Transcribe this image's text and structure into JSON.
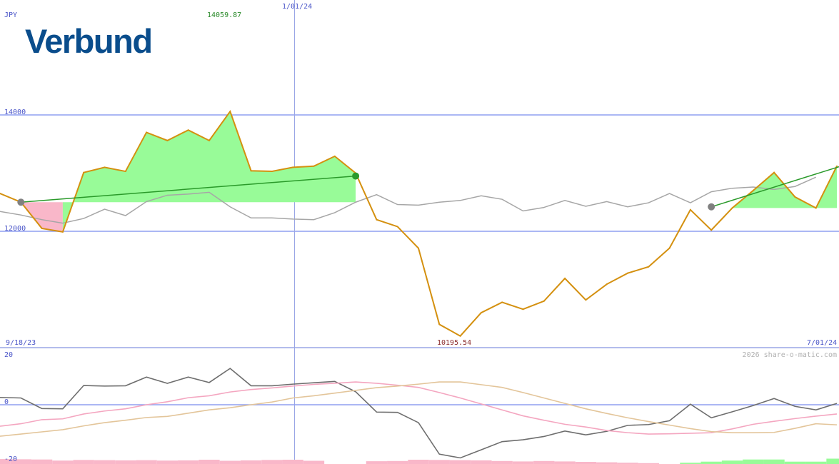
{
  "currency_label": "JPY",
  "logo_text": "Verbund",
  "watermark": "2026 share-o-matic.com",
  "colors": {
    "price": "#d4900f",
    "ma": "#a6a6a6",
    "gain_fill": "#98fb98",
    "loss_fill": "#f9b7c9",
    "trend": "#2a9a2a",
    "grid": "#8f9ff0",
    "divider": "#9aa6e6",
    "axis_text": "#4a55c8",
    "high_text": "#2a8a2a",
    "low_text": "#8a2a2a",
    "logo": "#0a4d8c",
    "osc_dark": "#6e6e6e",
    "osc_pink": "#f4a6c0",
    "osc_tan": "#e3c59a"
  },
  "chart_data": [
    {
      "type": "line",
      "currency": "JPY",
      "ylim": [
        10050,
        14250
      ],
      "x_range": [
        "9/18/23",
        "7/01/24"
      ],
      "x_tick_labels": [
        "9/18/23",
        "1/01/24",
        "7/01/24"
      ],
      "y_tick_labels": [
        "14000",
        "12000"
      ],
      "y_grid_values": [
        14000,
        12000
      ],
      "max_label": "14059.87",
      "min_label": "10195.54",
      "series": [
        {
          "key": "price",
          "x": [
            "2023-09-11",
            "2023-09-18",
            "2023-09-25",
            "2023-10-02",
            "2023-10-09",
            "2023-10-16",
            "2023-10-23",
            "2023-10-30",
            "2023-11-06",
            "2023-11-13",
            "2023-11-20",
            "2023-11-27",
            "2023-12-04",
            "2023-12-11",
            "2023-12-18",
            "2023-12-25",
            "2024-01-01",
            "2024-01-08",
            "2024-01-15",
            "2024-01-22",
            "2024-01-29",
            "2024-02-05",
            "2024-02-12",
            "2024-02-19",
            "2024-02-26",
            "2024-03-04",
            "2024-03-11",
            "2024-03-18",
            "2024-03-25",
            "2024-04-01",
            "2024-04-08",
            "2024-04-15",
            "2024-04-22",
            "2024-04-29",
            "2024-05-06",
            "2024-05-13",
            "2024-05-20",
            "2024-05-27",
            "2024-06-03",
            "2024-06-10",
            "2024-06-17",
            "2024-06-24",
            "2024-07-01"
          ],
          "y": [
            12650,
            12500,
            12050,
            11990,
            13010,
            13100,
            13030,
            13700,
            13560,
            13740,
            13560,
            14060,
            13040,
            13030,
            13100,
            13120,
            13290,
            13000,
            12200,
            12080,
            11710,
            10400,
            10200,
            10600,
            10780,
            10660,
            10800,
            11190,
            10820,
            11090,
            11280,
            11390,
            11710,
            12370,
            12020,
            12400,
            12700,
            13010,
            12590,
            12400,
            13120,
            null,
            null
          ]
        },
        {
          "key": "ma",
          "x": [
            "2023-09-11",
            "2023-09-18",
            "2023-09-25",
            "2023-10-02",
            "2023-10-09",
            "2023-10-16",
            "2023-10-23",
            "2023-10-30",
            "2023-11-06",
            "2023-11-13",
            "2023-11-20",
            "2023-11-27",
            "2023-12-04",
            "2023-12-11",
            "2023-12-18",
            "2023-12-25",
            "2024-01-01",
            "2024-01-08",
            "2024-01-15",
            "2024-01-22",
            "2024-01-29",
            "2024-02-05",
            "2024-02-12",
            "2024-02-19",
            "2024-02-26",
            "2024-03-04",
            "2024-03-11",
            "2024-03-18",
            "2024-03-25",
            "2024-04-01",
            "2024-04-08",
            "2024-04-15",
            "2024-04-22",
            "2024-04-29",
            "2024-05-06",
            "2024-05-13",
            "2024-05-20",
            "2024-05-27",
            "2024-06-03",
            "2024-06-10",
            "2024-06-17",
            "2024-06-24",
            "2024-07-01"
          ],
          "y": [
            12340,
            12280,
            12200,
            12140,
            12220,
            12380,
            12270,
            12510,
            12620,
            12640,
            12670,
            12420,
            12230,
            12230,
            12210,
            12200,
            12320,
            12500,
            12630,
            12460,
            12450,
            12500,
            12530,
            12610,
            12550,
            12350,
            12410,
            12530,
            12430,
            12510,
            12420,
            12490,
            12650,
            12490,
            12680,
            12740,
            12760,
            12720,
            12770,
            12930,
            null,
            null,
            null
          ]
        }
      ],
      "trend_lines": [
        {
          "x": [
            "2023-09-18",
            "2024-01-08"
          ],
          "y": [
            12500,
            12950
          ]
        },
        {
          "x": [
            "2024-05-06",
            "2024-07-01"
          ],
          "y": [
            12420,
            13110
          ]
        }
      ]
    },
    {
      "type": "line",
      "ylim": [
        -21,
        21
      ],
      "y_tick_labels": [
        "20",
        "0",
        "-20"
      ],
      "zero_line": 0,
      "series": [
        {
          "key": "osc_dark",
          "y": [
            2.7,
            2.5,
            -1.4,
            -1.5,
            7.1,
            6.9,
            7.0,
            10.2,
            7.9,
            10.2,
            8.2,
            13.4,
            7.0,
            7.0,
            7.6,
            8.1,
            8.6,
            4.8,
            -2.7,
            -2.8,
            -6.6,
            -18.2,
            -19.6,
            -16.6,
            -13.6,
            -12.9,
            -11.7,
            -9.7,
            -11.1,
            -9.8,
            -7.6,
            -7.3,
            -5.9,
            0.2,
            -4.8,
            -2.6,
            -0.3,
            2.3,
            -0.6,
            -1.9,
            0.5,
            null,
            null
          ]
        },
        {
          "key": "osc_pink",
          "y": [
            -7.9,
            -7.0,
            -5.5,
            -5.2,
            -3.4,
            -2.3,
            -1.5,
            0.0,
            1.1,
            2.6,
            3.3,
            4.7,
            5.6,
            6.2,
            6.9,
            7.5,
            7.9,
            8.4,
            7.9,
            7.2,
            6.4,
            4.5,
            2.5,
            0.3,
            -1.9,
            -4.1,
            -5.7,
            -7.2,
            -8.2,
            -9.5,
            -10.3,
            -10.8,
            -10.7,
            -10.5,
            -10.3,
            -8.9,
            -7.2,
            -6.1,
            -5.1,
            -4.2,
            -3.4,
            null,
            null
          ]
        },
        {
          "key": "osc_tan",
          "y": [
            -11.6,
            -10.8,
            -10.0,
            -9.2,
            -7.8,
            -6.6,
            -5.7,
            -4.7,
            -4.3,
            -3.1,
            -1.9,
            -1.1,
            0.0,
            1.0,
            2.5,
            3.3,
            4.3,
            5.3,
            6.3,
            6.9,
            7.6,
            8.4,
            8.4,
            7.4,
            6.4,
            4.5,
            2.5,
            0.5,
            -1.5,
            -3.2,
            -4.8,
            -6.2,
            -7.5,
            -8.8,
            -9.9,
            -10.3,
            -10.3,
            -10.2,
            -8.7,
            -7.0,
            -7.4,
            null,
            null
          ]
        }
      ],
      "histogram": [
        -2.3,
        -2.2,
        -2.1,
        -1.6,
        -1.9,
        -1.8,
        -1.7,
        -1.8,
        -1.6,
        -1.7,
        -2.0,
        -1.5,
        -1.7,
        -1.9,
        -2.0,
        -1.5,
        0,
        0,
        -1.3,
        -1.4,
        -2.0,
        -1.9,
        -1.8,
        -1.7,
        -1.4,
        -1.2,
        -1.4,
        -1.2,
        -1.0,
        -0.8,
        -0.6,
        -0.4,
        0,
        0.6,
        1.1,
        1.6,
        2.1,
        2.1,
        1.1,
        1.1,
        2.5,
        null,
        null
      ]
    }
  ]
}
